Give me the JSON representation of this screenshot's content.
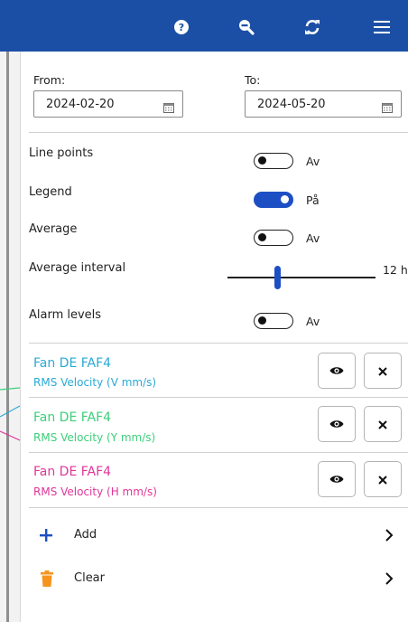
{
  "toolbar": {
    "help_icon": "help-circle-icon",
    "zoom_out_icon": "zoom-out-icon",
    "refresh_icon": "refresh-icon",
    "menu_icon": "hamburger-menu-icon",
    "background_color": "#1b4fa5"
  },
  "dates": {
    "from_label": "From:",
    "from_value": "2024-02-20",
    "to_label": "To:",
    "to_value": "2024-05-20"
  },
  "settings": {
    "line_points": {
      "label": "Line points",
      "state": "Av",
      "on": false
    },
    "legend": {
      "label": "Legend",
      "state": "På",
      "on": true
    },
    "average": {
      "label": "Average",
      "state": "Av",
      "on": false
    },
    "average_interval": {
      "label": "Average interval",
      "value": "12 h"
    },
    "alarm_levels": {
      "label": "Alarm levels",
      "state": "Av",
      "on": false
    }
  },
  "series": [
    {
      "name": "Fan DE FAF4",
      "measure": "RMS Velocity (V mm/s)",
      "color": "#29a9d6"
    },
    {
      "name": "Fan DE FAF4",
      "measure": "RMS Velocity (Y mm/s)",
      "color": "#3ccf7a"
    },
    {
      "name": "Fan DE FAF4",
      "measure": "RMS Velocity (H mm/s)",
      "color": "#e0369a"
    }
  ],
  "actions": {
    "add_label": "Add",
    "clear_label": "Clear",
    "add_color": "#1d4fc4",
    "clear_color": "#f7941d"
  },
  "accent_color": "#1d4fc4"
}
